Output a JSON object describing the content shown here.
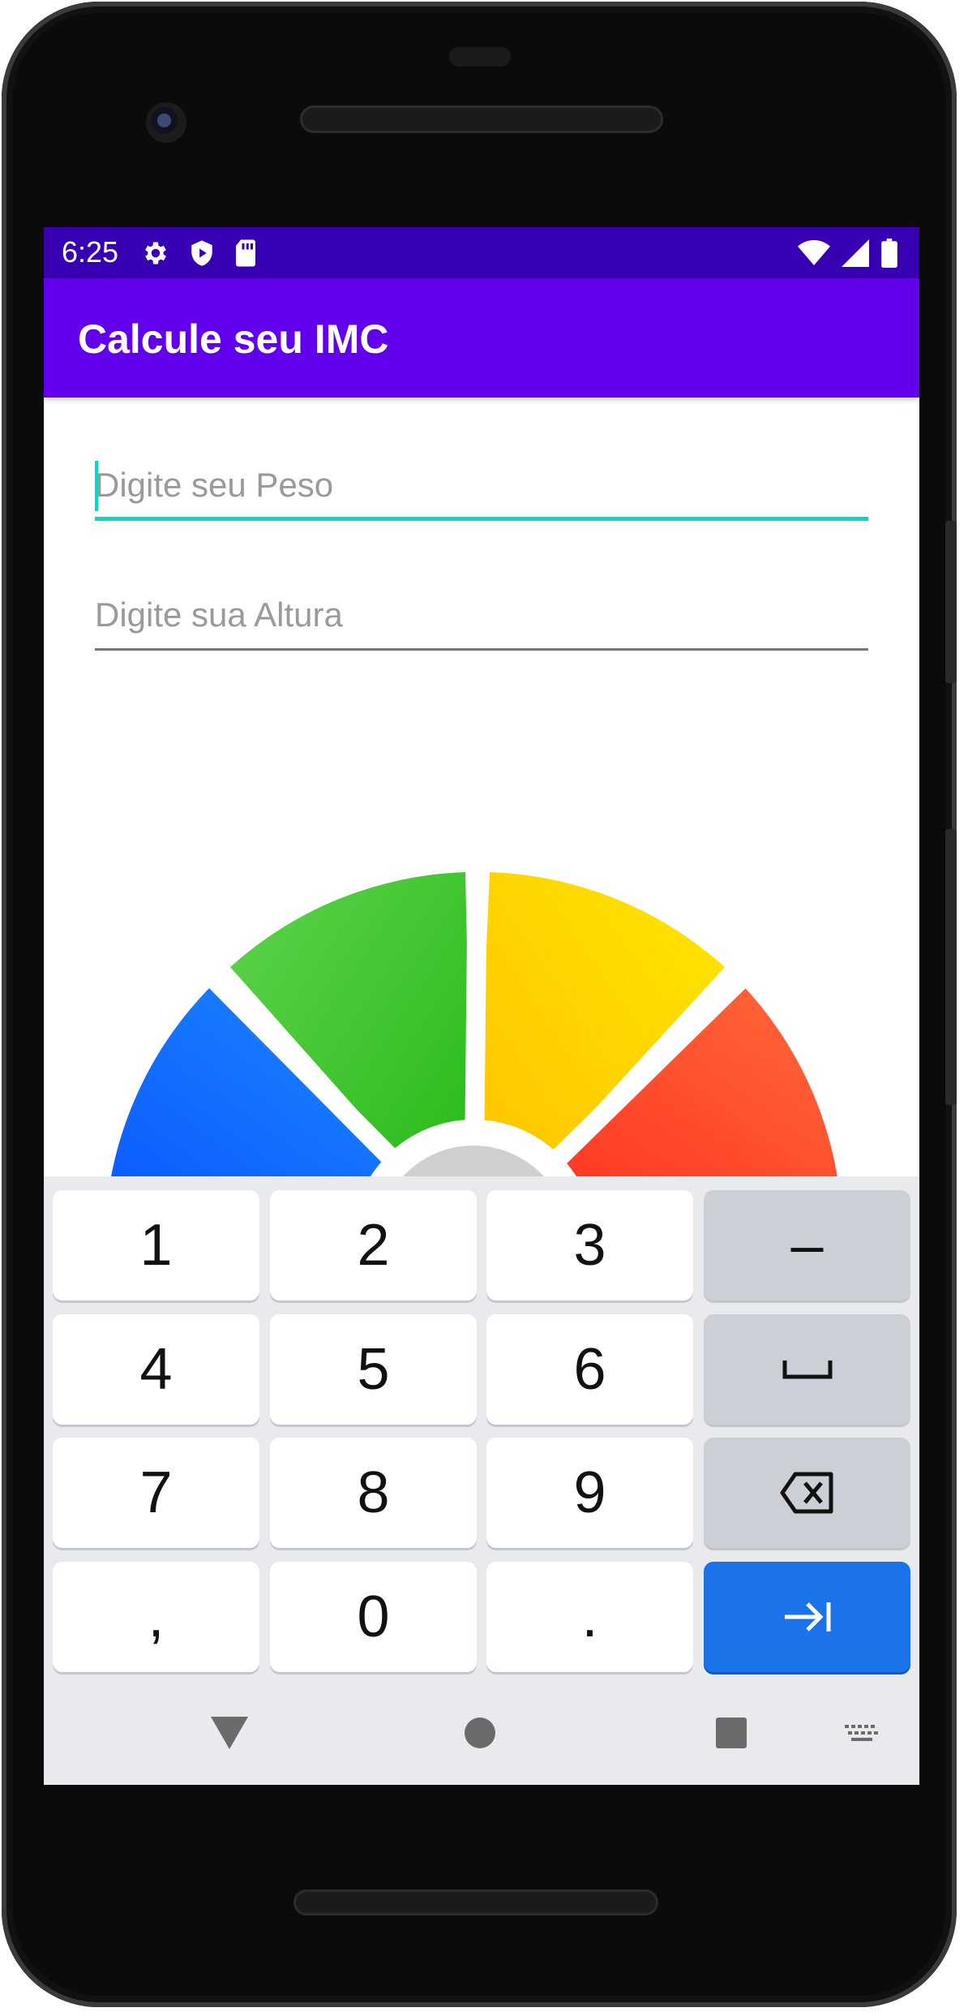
{
  "status_bar": {
    "time": "6:25"
  },
  "app_bar": {
    "title": "Calcule seu IMC"
  },
  "form": {
    "peso_placeholder": "Digite seu Peso",
    "altura_placeholder": "Digite sua Altura"
  },
  "gauge": {
    "segments": [
      {
        "color": "#1a73ff"
      },
      {
        "color": "#3cc23a"
      },
      {
        "color": "#ffd400"
      },
      {
        "color": "#ff4a26"
      }
    ]
  },
  "keyboard": {
    "keys": [
      [
        "1",
        "2",
        "3",
        "–"
      ],
      [
        "4",
        "5",
        "6",
        "␣"
      ],
      [
        "7",
        "8",
        "9",
        "⌫"
      ],
      [
        ",",
        "0",
        ".",
        "⇥"
      ]
    ]
  },
  "colors": {
    "status_bar": "#3700b3",
    "app_bar": "#6200ee",
    "accent": "#03dac5",
    "enter_key": "#1a73e8"
  }
}
